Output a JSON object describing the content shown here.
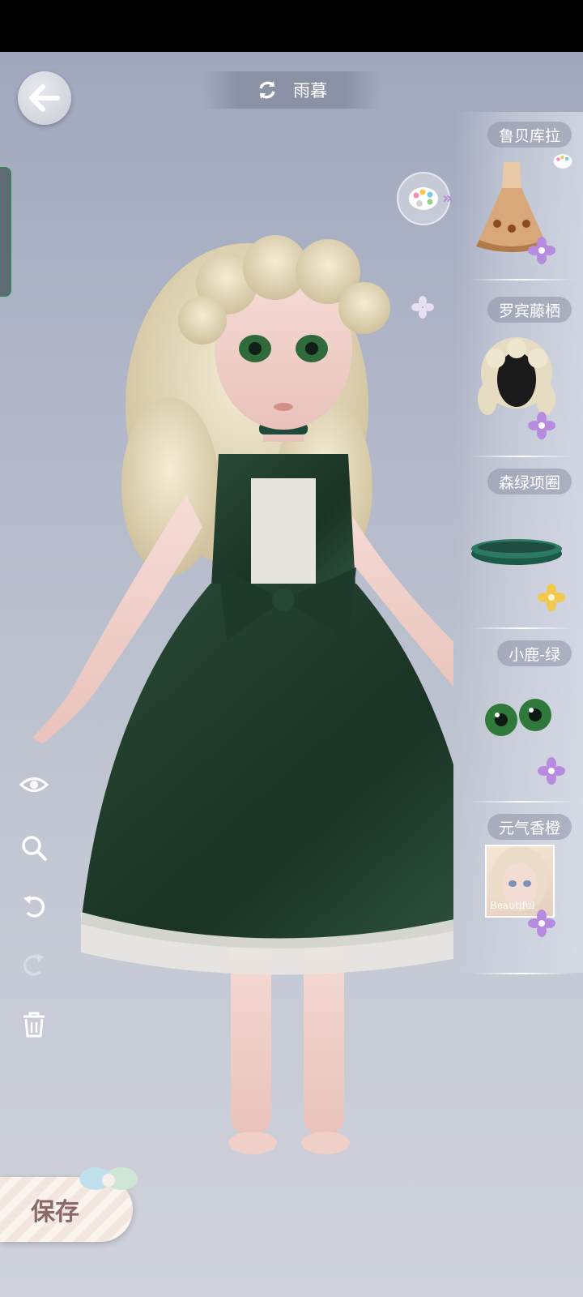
{
  "header": {
    "character_name": "雨暮"
  },
  "slots": [
    {
      "label": "鲁贝库拉",
      "icon": "dress-item-icon",
      "rarity": "purple"
    },
    {
      "label": "罗宾藤栖",
      "icon": "wig-item-icon",
      "rarity": "purple"
    },
    {
      "label": "森绿项圈",
      "icon": "choker-item-icon",
      "rarity": "gold"
    },
    {
      "label": "小鹿-绿",
      "icon": "eyes-item-icon",
      "rarity": "purple"
    },
    {
      "label": "元气香橙",
      "icon": "makeup-item-icon",
      "rarity": "purple"
    }
  ],
  "makeup_card_text": "Beautiful",
  "save_label": "保存",
  "colors": {
    "dress": "#1f3a2a",
    "hair": "#e8dcbc",
    "purple_flower": "#b78be0",
    "gold_flower": "#f2c94c"
  }
}
